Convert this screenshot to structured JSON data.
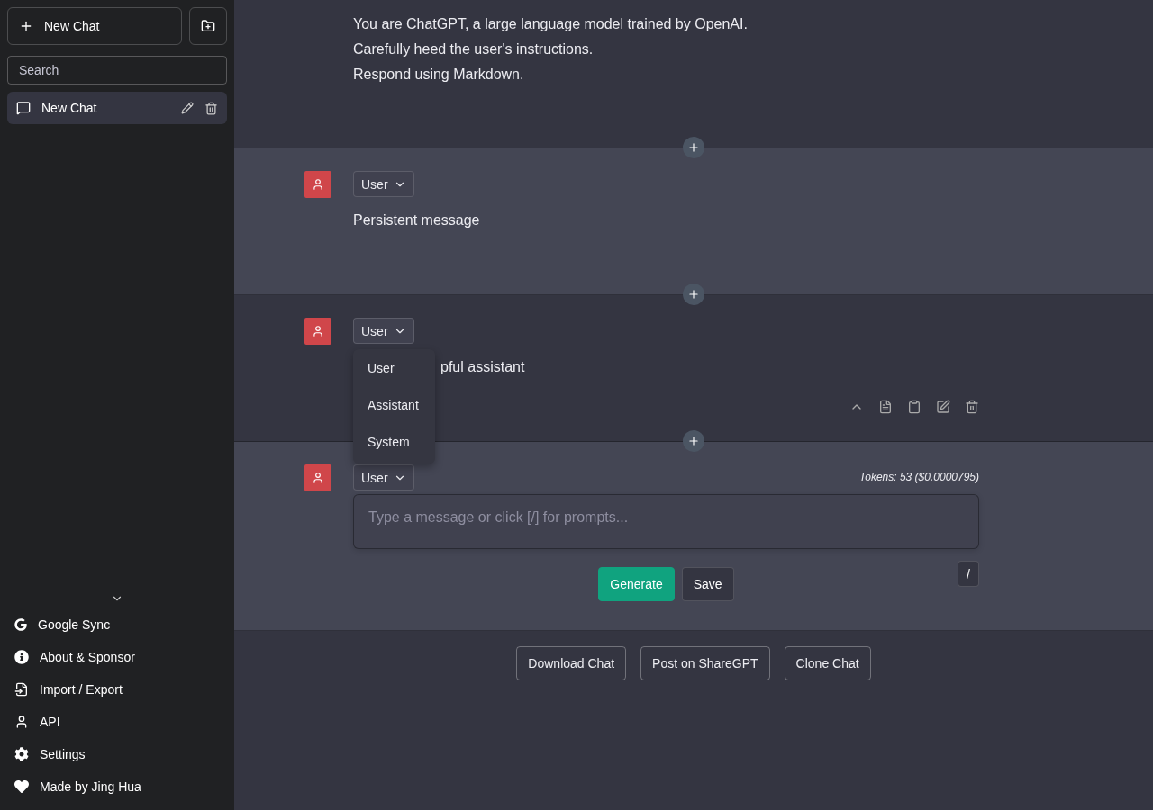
{
  "sidebar": {
    "new_chat_button": "New Chat",
    "search": {
      "placeholder": "Search"
    },
    "chats": [
      {
        "title": "New Chat",
        "selected": true
      }
    ],
    "menu": [
      {
        "kind": "google",
        "label": "Google Sync"
      },
      {
        "kind": "info",
        "label": "About & Sponsor"
      },
      {
        "kind": "import",
        "label": "Import / Export"
      },
      {
        "kind": "user",
        "label": "API"
      },
      {
        "kind": "settings",
        "label": "Settings"
      },
      {
        "kind": "heart",
        "label": "Made by Jing Hua"
      }
    ]
  },
  "messages": [
    {
      "kind": "view",
      "lines": [
        "You are ChatGPT, a large language model trained by OpenAI.",
        "Carefully heed the user's instructions.",
        "Respond using Markdown."
      ]
    },
    {
      "kind": "view",
      "role": "User",
      "lines": [
        "Persistent message"
      ]
    },
    {
      "kind": "view",
      "role": "User",
      "lines": [
        "pful assistant"
      ],
      "role_menu": [
        "User",
        "Assistant",
        "System"
      ],
      "toolbar_shown": true
    },
    {
      "kind": "edit",
      "role": "User",
      "tokens": "Tokens: 53 ($0.0000795)",
      "input": {
        "placeholder": "Type a message or click [/] for prompts..."
      },
      "buttons": [
        "Generate",
        "Save"
      ],
      "prompt_key": "/"
    }
  ],
  "chat_actions": [
    "Download Chat",
    "Post on ShareGPT",
    "Clone Chat"
  ]
}
